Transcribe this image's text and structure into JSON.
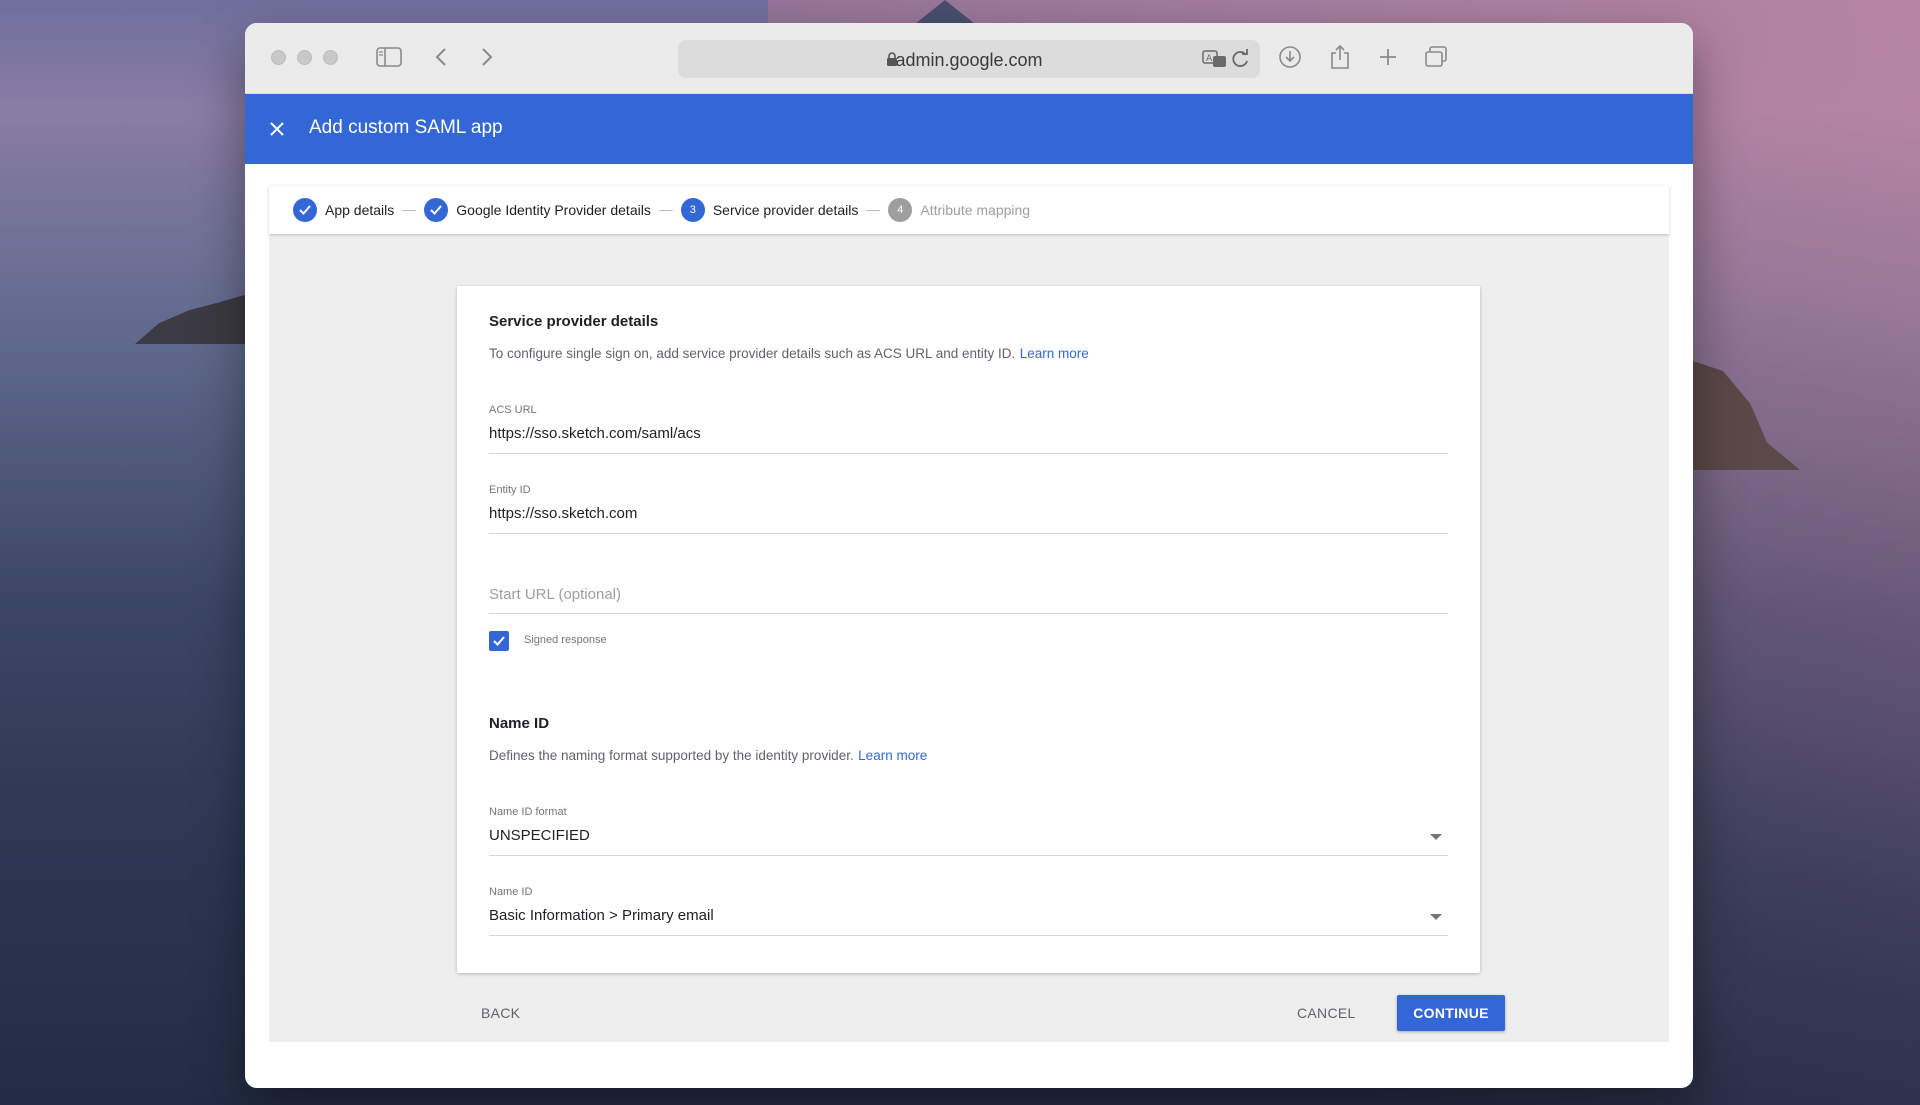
{
  "browser": {
    "url": "admin.google.com"
  },
  "appbar": {
    "title": "Add custom SAML app"
  },
  "stepper": {
    "steps": [
      {
        "label": "App details",
        "state": "done"
      },
      {
        "label": "Google Identity Provider details",
        "state": "done"
      },
      {
        "label": "Service provider details",
        "state": "active",
        "number": "3"
      },
      {
        "label": "Attribute mapping",
        "state": "pending",
        "number": "4"
      }
    ]
  },
  "service_provider": {
    "title": "Service provider details",
    "description": "To configure single sign on, add service provider details such as ACS URL and entity ID.",
    "learn_more": "Learn more",
    "acs_url": {
      "label": "ACS URL",
      "value": "https://sso.sketch.com/saml/acs"
    },
    "entity_id": {
      "label": "Entity ID",
      "value": "https://sso.sketch.com"
    },
    "start_url": {
      "placeholder": "Start URL (optional)"
    },
    "signed_response": {
      "label": "Signed response",
      "checked": true
    }
  },
  "name_id": {
    "title": "Name ID",
    "description": "Defines the naming format supported by the identity provider.",
    "learn_more": "Learn more",
    "format": {
      "label": "Name ID format",
      "value": "UNSPECIFIED"
    },
    "name_id": {
      "label": "Name ID",
      "value": "Basic Information > Primary email"
    }
  },
  "actions": {
    "back": "BACK",
    "cancel": "CANCEL",
    "continue": "CONTINUE"
  },
  "colors": {
    "accent": "#3367d6"
  }
}
